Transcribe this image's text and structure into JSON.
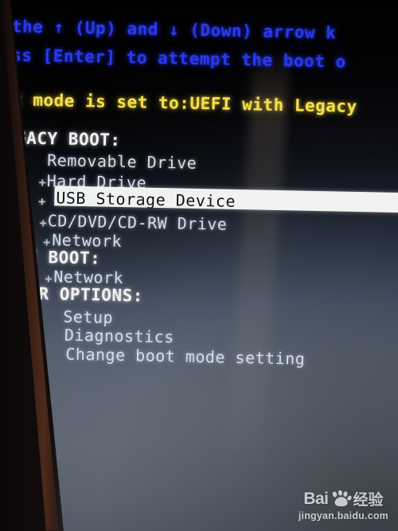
{
  "screen": {
    "kind": "bios-boot-device-menu",
    "background_top_color": "#000000",
    "background_bottom_color": "#525b68",
    "accent_blue": "#2a38ee",
    "accent_yellow": "#f6e24c",
    "text_color": "#d9dde6",
    "selection_bg": "#f2f3f3",
    "selection_fg": "#101218"
  },
  "instructions": [
    {
      "text": "e the ↑ (Up) and ↓ (Down) arrow k",
      "color": "blue"
    },
    {
      "text": "ress [Enter] to attempt the boot o",
      "color": "blue"
    }
  ],
  "boot_mode_notice": {
    "text": "oot mode is set to:UEFI with Legacy",
    "color": "yellow"
  },
  "sections": [
    {
      "heading": "LEGACY BOOT:",
      "items": [
        {
          "label": "Removable Drive",
          "bullet": "",
          "selected": false
        },
        {
          "label": "Hard Drive",
          "bullet": "+",
          "selected": false
        },
        {
          "label": "USB Storage Device",
          "bullet": "+",
          "selected": true
        },
        {
          "label": "CD/DVD/CD-RW Drive",
          "bullet": "+",
          "selected": false
        },
        {
          "label": "Network",
          "bullet": "+",
          "selected": false
        }
      ]
    },
    {
      "heading": "UEFI BOOT:",
      "items": [
        {
          "label": "Network",
          "bullet": "+",
          "selected": false
        }
      ]
    },
    {
      "heading": "OTHER OPTIONS:",
      "items": [
        {
          "label": "Setup",
          "bullet": "",
          "selected": false
        },
        {
          "label": "Diagnostics",
          "bullet": "",
          "selected": false
        },
        {
          "label": "Change boot mode setting",
          "bullet": "",
          "selected": false
        }
      ]
    }
  ],
  "watermark": {
    "brand_latin": "Bai",
    "brand_cn": "经验",
    "url": "jingyan.baidu.com",
    "icon": "baidu-paw-icon"
  }
}
